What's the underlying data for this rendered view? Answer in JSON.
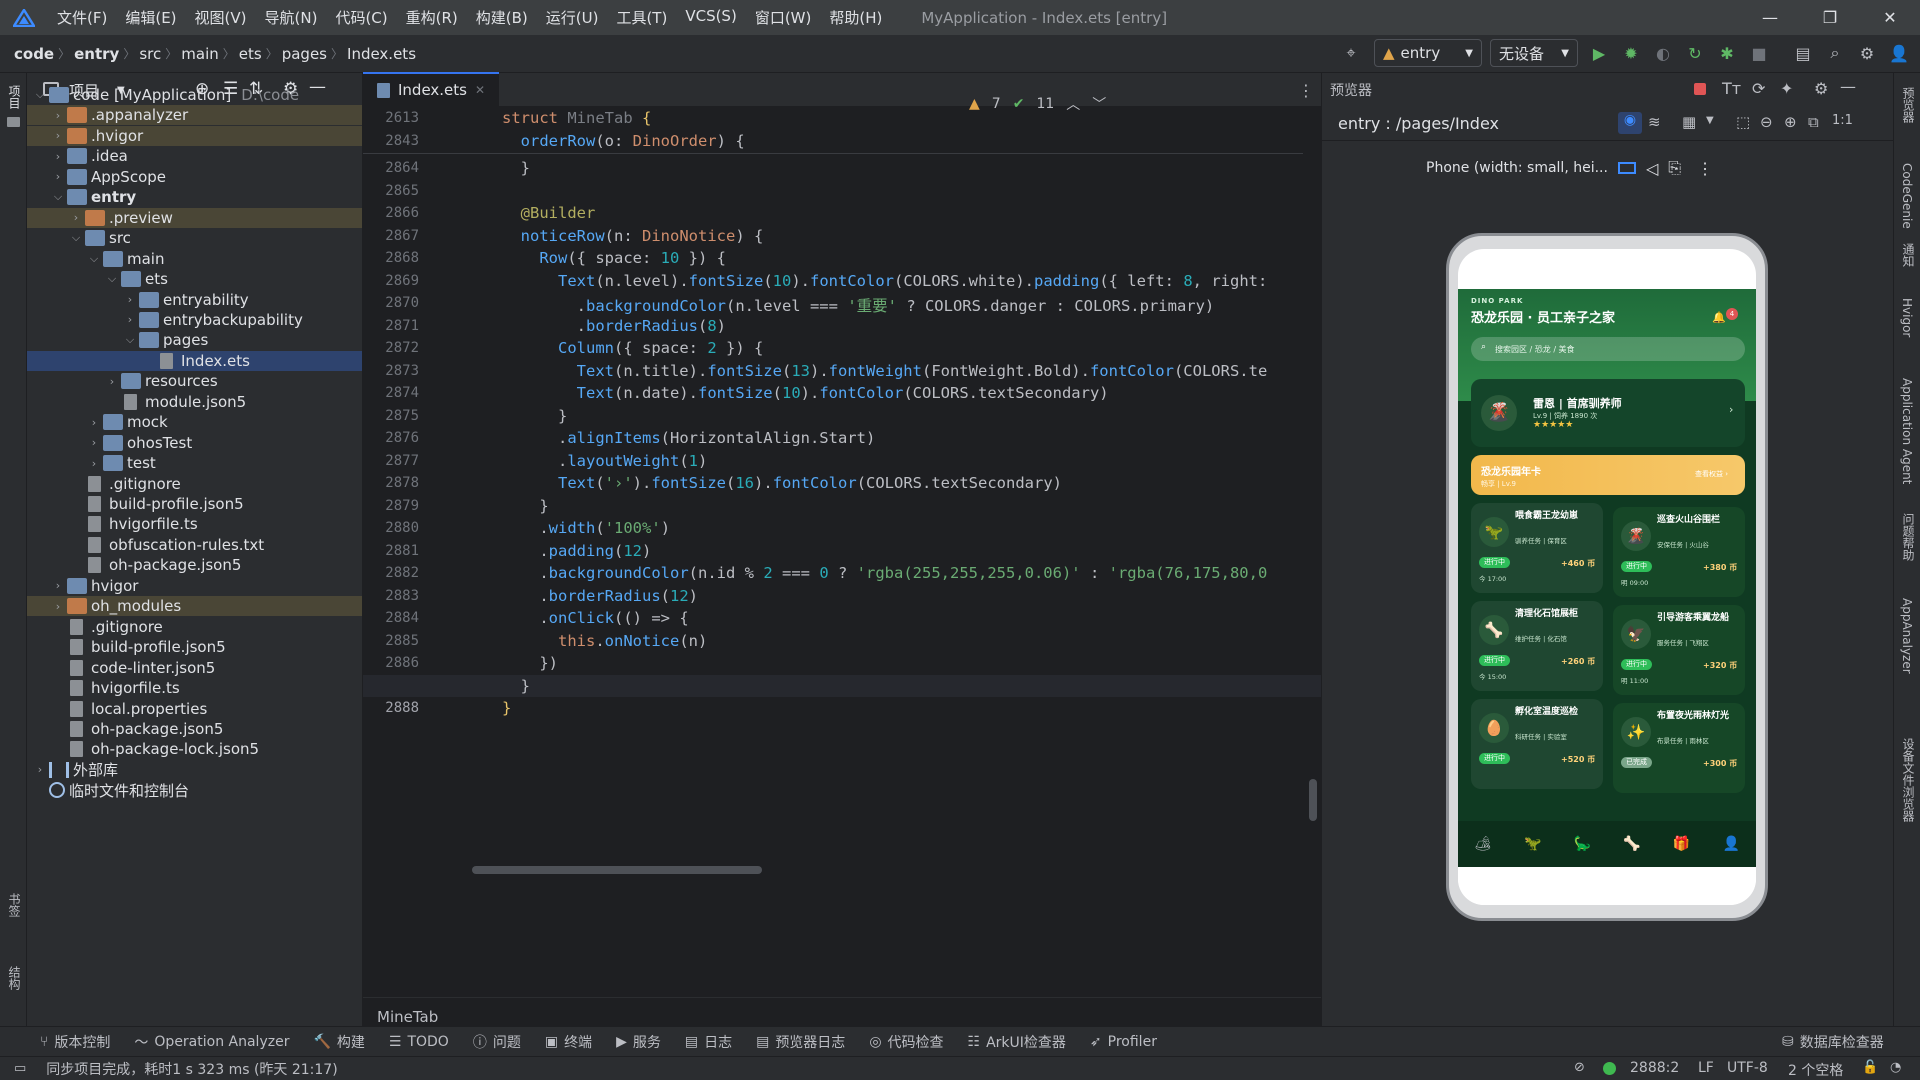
{
  "menubar": {
    "items": [
      "文件(F)",
      "编辑(E)",
      "视图(V)",
      "导航(N)",
      "代码(C)",
      "重构(R)",
      "构建(B)",
      "运行(U)",
      "工具(T)",
      "VCS(S)",
      "窗口(W)",
      "帮助(H)"
    ],
    "window_title": "MyApplication - Index.ets [entry]"
  },
  "breadcrumb": [
    "code",
    "entry",
    "src",
    "main",
    "ets",
    "pages",
    "Index.ets"
  ],
  "toolbar": {
    "module_select": "entry",
    "device_select": "无设备"
  },
  "left_strip": {
    "project_label": "项目",
    "bookmarks_label": "书签",
    "structure_label": "结构"
  },
  "right_strip": [
    "预览器",
    "CodeGenie",
    "通知",
    "Hvigor",
    "Application Agent",
    "问题帮助",
    "AppAnalyzer",
    "设备文件浏览器"
  ],
  "project_panel": {
    "title": "项目",
    "tree": [
      {
        "label": "code [MyApplication]",
        "hint": "D:\\code",
        "depth": 0,
        "arrow": "v",
        "icon": "folder"
      },
      {
        "label": ".appanalyzer",
        "depth": 1,
        "arrow": ">",
        "icon": "folder-orange",
        "hl": true
      },
      {
        "label": ".hvigor",
        "depth": 1,
        "arrow": ">",
        "icon": "folder-orange",
        "hl": true
      },
      {
        "label": ".idea",
        "depth": 1,
        "arrow": ">",
        "icon": "folder"
      },
      {
        "label": "AppScope",
        "depth": 1,
        "arrow": ">",
        "icon": "folder"
      },
      {
        "label": "entry",
        "depth": 1,
        "arrow": "v",
        "icon": "folder",
        "bold": true
      },
      {
        "label": ".preview",
        "depth": 2,
        "arrow": ">",
        "icon": "folder-orange",
        "hl": true
      },
      {
        "label": "src",
        "depth": 2,
        "arrow": "v",
        "icon": "folder"
      },
      {
        "label": "main",
        "depth": 3,
        "arrow": "v",
        "icon": "folder"
      },
      {
        "label": "ets",
        "depth": 4,
        "arrow": "v",
        "icon": "folder"
      },
      {
        "label": "entryability",
        "depth": 5,
        "arrow": ">",
        "icon": "folder"
      },
      {
        "label": "entrybackupability",
        "depth": 5,
        "arrow": ">",
        "icon": "folder"
      },
      {
        "label": "pages",
        "depth": 5,
        "arrow": "v",
        "icon": "folder"
      },
      {
        "label": "Index.ets",
        "depth": 6,
        "arrow": "",
        "icon": "file",
        "sel": true
      },
      {
        "label": "resources",
        "depth": 4,
        "arrow": ">",
        "icon": "folder"
      },
      {
        "label": "module.json5",
        "depth": 4,
        "arrow": "",
        "icon": "file"
      },
      {
        "label": "mock",
        "depth": 3,
        "arrow": ">",
        "icon": "folder"
      },
      {
        "label": "ohosTest",
        "depth": 3,
        "arrow": ">",
        "icon": "folder"
      },
      {
        "label": "test",
        "depth": 3,
        "arrow": ">",
        "icon": "folder"
      },
      {
        "label": ".gitignore",
        "depth": 2,
        "arrow": "",
        "icon": "file"
      },
      {
        "label": "build-profile.json5",
        "depth": 2,
        "arrow": "",
        "icon": "file"
      },
      {
        "label": "hvigorfile.ts",
        "depth": 2,
        "arrow": "",
        "icon": "file"
      },
      {
        "label": "obfuscation-rules.txt",
        "depth": 2,
        "arrow": "",
        "icon": "file"
      },
      {
        "label": "oh-package.json5",
        "depth": 2,
        "arrow": "",
        "icon": "file"
      },
      {
        "label": "hvigor",
        "depth": 1,
        "arrow": ">",
        "icon": "folder"
      },
      {
        "label": "oh_modules",
        "depth": 1,
        "arrow": ">",
        "icon": "folder-orange",
        "hl": true
      },
      {
        "label": ".gitignore",
        "depth": 1,
        "arrow": "",
        "icon": "file"
      },
      {
        "label": "build-profile.json5",
        "depth": 1,
        "arrow": "",
        "icon": "file"
      },
      {
        "label": "code-linter.json5",
        "depth": 1,
        "arrow": "",
        "icon": "file"
      },
      {
        "label": "hvigorfile.ts",
        "depth": 1,
        "arrow": "",
        "icon": "file"
      },
      {
        "label": "local.properties",
        "depth": 1,
        "arrow": "",
        "icon": "file"
      },
      {
        "label": "oh-package.json5",
        "depth": 1,
        "arrow": "",
        "icon": "file"
      },
      {
        "label": "oh-package-lock.json5",
        "depth": 1,
        "arrow": "",
        "icon": "file"
      },
      {
        "label": "外部库",
        "depth": 0,
        "arrow": ">",
        "icon": "lib"
      },
      {
        "label": "临时文件和控制台",
        "depth": 0,
        "arrow": "",
        "icon": "scratch"
      }
    ]
  },
  "editor": {
    "tab_label": "Index.ets",
    "inspections": {
      "warnings": "7",
      "weak_warnings": "11"
    },
    "sticky_lines": [
      {
        "num": "2613",
        "html": "<span class='kw'>struct</span> <span class='dim'>MineTab</span> <span style='color:#e8c46a'>{</span>"
      },
      {
        "num": "2843",
        "html": "  <span class='fn'>orderRow</span>(o: <span class='kw'>DinoOrder</span>) {"
      }
    ],
    "lines": [
      {
        "num": "2864",
        "html": "  }"
      },
      {
        "num": "2865",
        "html": ""
      },
      {
        "num": "2866",
        "html": "  <span class='ann'>@Builder</span>"
      },
      {
        "num": "2867",
        "html": "  <span class='fn'>noticeRow</span>(n: <span class='kw'>DinoNotice</span>) {"
      },
      {
        "num": "2868",
        "html": "    <span class='fn'>Row</span>({ space: <span class='num'>10</span> }) {"
      },
      {
        "num": "2869",
        "html": "      <span class='fn'>Text</span>(n.level).<span class='fn'>fontSize</span>(<span class='num'>10</span>).<span class='fn'>fontColor</span>(COLORS.white).<span class='fn'>padding</span>({ left: <span class='num'>8</span>, right:"
      },
      {
        "num": "2870",
        "html": "        .<span class='fn'>backgroundColor</span>(n.level === <span class='str'>'重要'</span> ? COLORS.danger : COLORS.primary)"
      },
      {
        "num": "2871",
        "html": "        .<span class='fn'>borderRadius</span>(<span class='num'>8</span>)"
      },
      {
        "num": "2872",
        "html": "      <span class='fn'>Column</span>({ space: <span class='num'>2</span> }) {"
      },
      {
        "num": "2873",
        "html": "        <span class='fn'>Text</span>(n.title).<span class='fn'>fontSize</span>(<span class='num'>13</span>).<span class='fn'>fontWeight</span>(FontWeight.Bold).<span class='fn'>fontColor</span>(COLORS.te"
      },
      {
        "num": "2874",
        "html": "        <span class='fn'>Text</span>(n.date).<span class='fn'>fontSize</span>(<span class='num'>10</span>).<span class='fn'>fontColor</span>(COLORS.textSecondary)"
      },
      {
        "num": "2875",
        "html": "      }"
      },
      {
        "num": "2876",
        "html": "      .<span class='fn'>alignItems</span>(HorizontalAlign.Start)"
      },
      {
        "num": "2877",
        "html": "      .<span class='fn'>layoutWeight</span>(<span class='num'>1</span>)"
      },
      {
        "num": "2878",
        "html": "      <span class='fn'>Text</span>(<span class='str'>'›'</span>).<span class='fn'>fontSize</span>(<span class='num'>16</span>).<span class='fn'>fontColor</span>(COLORS.textSecondary)"
      },
      {
        "num": "2879",
        "html": "    }"
      },
      {
        "num": "2880",
        "html": "    .<span class='fn'>width</span>(<span class='str'>'100%'</span>)"
      },
      {
        "num": "2881",
        "html": "    .<span class='fn'>padding</span>(<span class='num'>12</span>)"
      },
      {
        "num": "2882",
        "html": "    .<span class='fn'>backgroundColor</span>(n.id % <span class='num'>2</span> === <span class='num'>0</span> ? <span class='str'>'rgba(255,255,255,0.06)'</span> : <span class='str'>'rgba(76,175,80,0</span>"
      },
      {
        "num": "2883",
        "html": "    .<span class='fn'>borderRadius</span>(<span class='num'>12</span>)"
      },
      {
        "num": "2884",
        "html": "    .<span class='fn'>onClick</span>(() => {"
      },
      {
        "num": "2885",
        "html": "      <span class='kw'>this</span>.<span class='fn'>onNotice</span>(n)"
      },
      {
        "num": "2886",
        "html": "    })"
      },
      {
        "num": "2887",
        "html": "  }"
      },
      {
        "num": "2888",
        "html": "<span style='color:#e8c46a'>}</span>"
      }
    ],
    "breadcrumb_bottom": "MineTab"
  },
  "previewer": {
    "title": "预览器",
    "route": "entry : /pages/Index",
    "device": "Phone (width: small, hei...",
    "app": {
      "brand": "DINO PARK",
      "title": "恐龙乐园 · 员工亲子之家",
      "notif_count": "4",
      "search_placeholder": "搜索园区 / 恐龙 / 美食",
      "profile_name": "雷恩 | 首席驯养师",
      "profile_meta": "Lv.9 | 饲养 1890 次",
      "stars": "★★★★★",
      "membership": "恐龙乐园年卡",
      "membership_sub": "畅享 | Lv.9",
      "membership_link": "查看权益 ›",
      "tasks": [
        {
          "title": "喂食霸王龙幼崽",
          "meta": "驯养任务 | 保育区",
          "status": "进行中",
          "coin": "+460 币",
          "time": "今 17:00",
          "icon": "🦖"
        },
        {
          "title": "巡查火山谷围栏",
          "meta": "安保任务 | 火山谷",
          "status": "进行中",
          "coin": "+380 币",
          "time": "明 09:00",
          "icon": "🌋"
        },
        {
          "title": "清理化石馆展柜",
          "meta": "维护任务 | 化石馆",
          "status": "进行中",
          "coin": "+260 币",
          "time": "今 15:00",
          "icon": "🦴"
        },
        {
          "title": "引导游客乘翼龙船",
          "meta": "服务任务 | 飞翔区",
          "status": "进行中",
          "coin": "+320 币",
          "time": "明 11:00",
          "icon": "🦅"
        },
        {
          "title": "孵化室温度巡检",
          "meta": "科研任务 | 实验室",
          "status": "进行中",
          "coin": "+520 币",
          "time": "",
          "icon": "🥚"
        },
        {
          "title": "布置夜光雨林灯光",
          "meta": "布景任务 | 雨林区",
          "status": "已完成",
          "coin": "+300 币",
          "time": "",
          "icon": "✨"
        }
      ],
      "nav_icons": [
        "🏕",
        "🦖",
        "🦕",
        "🦴",
        "🎁",
        "👤"
      ]
    }
  },
  "bottom_tools": [
    "版本控制",
    "Operation Analyzer",
    "构建",
    "TODO",
    "问题",
    "终端",
    "服务",
    "日志",
    "预览器日志",
    "代码检查",
    "ArkUI检查器",
    "Profiler"
  ],
  "bottom_right_tool": "数据库检查器",
  "status": {
    "message": "同步项目完成，耗时1 s 323 ms (昨天 21:17)",
    "position": "2888:2",
    "line_ending": "LF",
    "encoding": "UTF-8",
    "indent": "2 个空格"
  },
  "colors": {
    "accent": "#3574f0",
    "app_green": "#2e8b4a",
    "app_dark": "#0f3a22",
    "app_gold": "#f2b84b"
  }
}
